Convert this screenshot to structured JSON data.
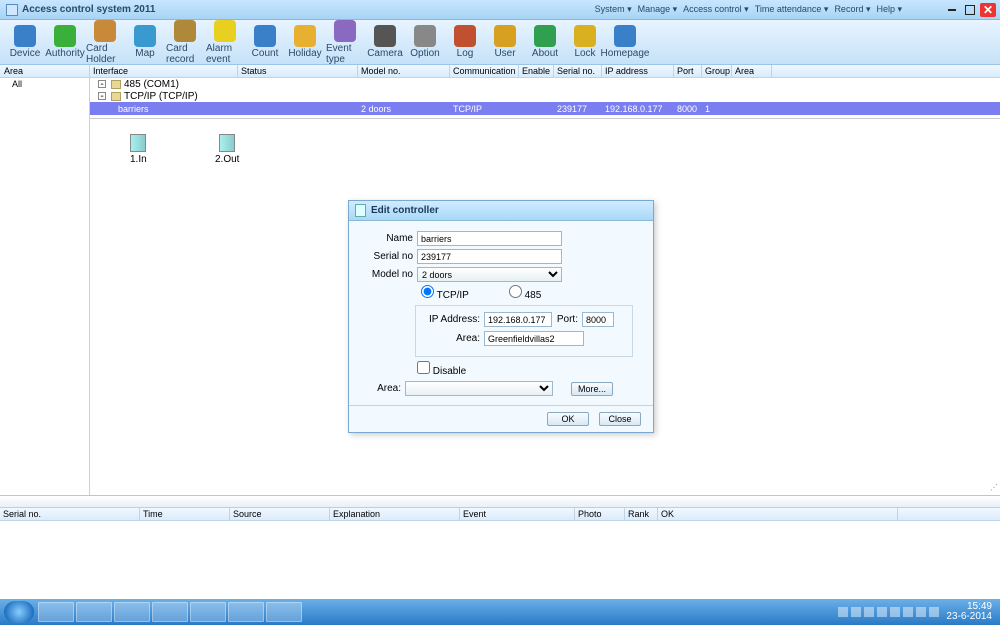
{
  "window": {
    "title": "Access control system 2011"
  },
  "menus": [
    "System ▾",
    "Manage ▾",
    "Access control ▾",
    "Time attendance ▾",
    "Record ▾",
    "Help ▾"
  ],
  "tools": [
    {
      "label": "Device",
      "c": "#3a80c8"
    },
    {
      "label": "Authority",
      "c": "#3ab03a"
    },
    {
      "label": "Card Holder",
      "c": "#c88a3a"
    },
    {
      "label": "Map",
      "c": "#3a9ad0"
    },
    {
      "label": "Card record",
      "c": "#b0883a"
    },
    {
      "label": "Alarm event",
      "c": "#e8d020"
    },
    {
      "label": "Count",
      "c": "#3a80c8"
    },
    {
      "label": "Holiday",
      "c": "#e8b030"
    },
    {
      "label": "Event type",
      "c": "#8a6ac0"
    },
    {
      "label": "Camera",
      "c": "#555"
    },
    {
      "label": "Option",
      "c": "#888"
    },
    {
      "label": "Log",
      "c": "#c05030"
    },
    {
      "label": "User",
      "c": "#d8a020"
    },
    {
      "label": "About",
      "c": "#30a050"
    },
    {
      "label": "Lock",
      "c": "#d8b020"
    },
    {
      "label": "Homepage",
      "c": "#3a80c8"
    }
  ],
  "left": {
    "header": "Area",
    "items": [
      "All"
    ]
  },
  "grid": {
    "headers": [
      "Interface",
      "Status",
      "Model no.",
      "Communication",
      "Enable",
      "Serial no.",
      "IP address",
      "Port",
      "Group",
      "Area"
    ],
    "widths": [
      148,
      120,
      92,
      69,
      35,
      48,
      72,
      28,
      30,
      40
    ],
    "tree": [
      {
        "exp": "-",
        "label": "485 (COM1)"
      },
      {
        "exp": "-",
        "label": "TCP/IP (TCP/IP)"
      }
    ],
    "selected": {
      "name": "barriers",
      "status": "",
      "model": "2 doors",
      "comm": "TCP/IP",
      "enable": "",
      "serial": "239177",
      "ip": "192.168.0.177",
      "port": "8000",
      "group": "1",
      "area": ""
    }
  },
  "doors": [
    {
      "label": "1.In"
    },
    {
      "label": "2.Out"
    }
  ],
  "events": {
    "headers": [
      "Serial no.",
      "Time",
      "Source",
      "Explanation",
      "Event",
      "Photo",
      "Rank",
      "OK"
    ],
    "widths": [
      140,
      90,
      100,
      130,
      115,
      50,
      33,
      240
    ]
  },
  "modal": {
    "title": "Edit controller",
    "name_label": "Name",
    "name": "barriers",
    "serial_label": "Serial no",
    "serial": "239177",
    "model_label": "Model no",
    "model": "2 doors",
    "radio_tcpip": "TCP/IP",
    "radio_485": "485",
    "ip_label": "IP Address:",
    "ip": "192.168.0.177",
    "port_label": "Port:",
    "port": "8000",
    "area_inner_label": "Area:",
    "area_inner": "Greenfieldvillas2",
    "disable": "Disable",
    "area_label": "Area:",
    "more": "More...",
    "ok": "OK",
    "close": "Close"
  },
  "taskbar": {
    "time": "15:49",
    "date": "23-6-2014"
  }
}
